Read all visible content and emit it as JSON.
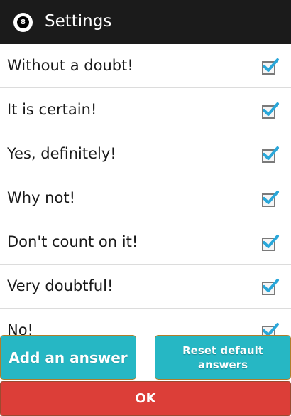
{
  "header": {
    "icon": "eight-ball-icon",
    "icon_text": "8",
    "title": "Settings",
    "background": "#1b1b1b"
  },
  "answers": [
    {
      "label": "Without a doubt!",
      "checked": true
    },
    {
      "label": "It is certain!",
      "checked": true
    },
    {
      "label": "Yes, definitely!",
      "checked": true
    },
    {
      "label": "Why not!",
      "checked": true
    },
    {
      "label": "Don't count on it!",
      "checked": true
    },
    {
      "label": "Very doubtful!",
      "checked": true
    },
    {
      "label": "No!",
      "checked": true
    }
  ],
  "buttons": {
    "add_label": "Add an answer",
    "reset_label": "Reset default answers",
    "ok_label": "OK"
  },
  "colors": {
    "accent": "#26b7c4",
    "ok": "#dc3e38",
    "check": "#2aa7d9"
  }
}
